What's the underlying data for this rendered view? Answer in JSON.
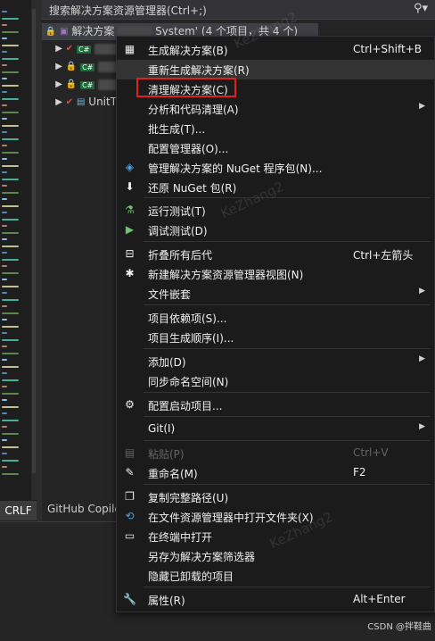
{
  "search": {
    "text": "搜索解决方案资源管理器(Ctrl+;)"
  },
  "tree": {
    "solution_text": "解决方案",
    "solution_suffix": "System' (4 个项目，共 4 个)",
    "projects": [
      {
        "name": "",
        "has_check": true
      },
      {
        "name": "",
        "has_check": false
      },
      {
        "name": "",
        "has_check": false
      },
      {
        "name": "UnitT",
        "has_check": true
      }
    ]
  },
  "menu": {
    "items": [
      {
        "label": "生成解决方案(B)",
        "shortcut": "Ctrl+Shift+B",
        "icon": "build-icon"
      },
      {
        "label": "重新生成解决方案(R)",
        "shortcut": ""
      },
      {
        "label": "清理解决方案(C)",
        "shortcut": ""
      },
      {
        "label": "分析和代码清理(A)",
        "shortcut": "",
        "submenu": true
      },
      {
        "label": "批生成(T)...",
        "shortcut": ""
      },
      {
        "label": "配置管理器(O)...",
        "shortcut": ""
      },
      {
        "label": "管理解决方案的 NuGet 程序包(N)...",
        "shortcut": "",
        "icon": "nuget-icon"
      },
      {
        "label": "还原 NuGet 包(R)",
        "shortcut": "",
        "icon": "restore-icon"
      },
      {
        "label": "运行测试(T)",
        "shortcut": "",
        "icon": "flask-icon"
      },
      {
        "label": "调试测试(D)",
        "shortcut": "",
        "icon": "debug-test-icon"
      },
      {
        "label": "折叠所有后代",
        "shortcut": "Ctrl+左箭头",
        "icon": "collapse-icon"
      },
      {
        "label": "新建解决方案资源管理器视图(N)",
        "shortcut": "",
        "icon": "new-view-icon"
      },
      {
        "label": "文件嵌套",
        "shortcut": "",
        "submenu": true
      },
      {
        "label": "项目依赖项(S)...",
        "shortcut": ""
      },
      {
        "label": "项目生成顺序(I)...",
        "shortcut": ""
      },
      {
        "label": "添加(D)",
        "shortcut": "",
        "submenu": true
      },
      {
        "label": "同步命名空间(N)",
        "shortcut": ""
      },
      {
        "label": "配置启动项目...",
        "shortcut": "",
        "icon": "gear-icon"
      },
      {
        "label": "Git(I)",
        "shortcut": "",
        "submenu": true
      },
      {
        "label": "粘贴(P)",
        "shortcut": "Ctrl+V",
        "icon": "paste-icon",
        "disabled": true
      },
      {
        "label": "重命名(M)",
        "shortcut": "F2",
        "icon": "rename-icon"
      },
      {
        "label": "复制完整路径(U)",
        "shortcut": "",
        "icon": "copy-icon"
      },
      {
        "label": "在文件资源管理器中打开文件夹(X)",
        "shortcut": "",
        "icon": "folder-sync-icon"
      },
      {
        "label": "在终端中打开",
        "shortcut": "",
        "icon": "terminal-icon"
      },
      {
        "label": "另存为解决方案筛选器",
        "shortcut": ""
      },
      {
        "label": "隐藏已卸载的项目",
        "shortcut": ""
      },
      {
        "label": "属性(R)",
        "shortcut": "Alt+Enter",
        "icon": "wrench-icon"
      }
    ]
  },
  "status": {
    "crlf": "CRLF",
    "github": "GitHub Copilo"
  },
  "watermark": {
    "text": "KeZhang2"
  },
  "csdn": "CSDN @拌鞋曲"
}
